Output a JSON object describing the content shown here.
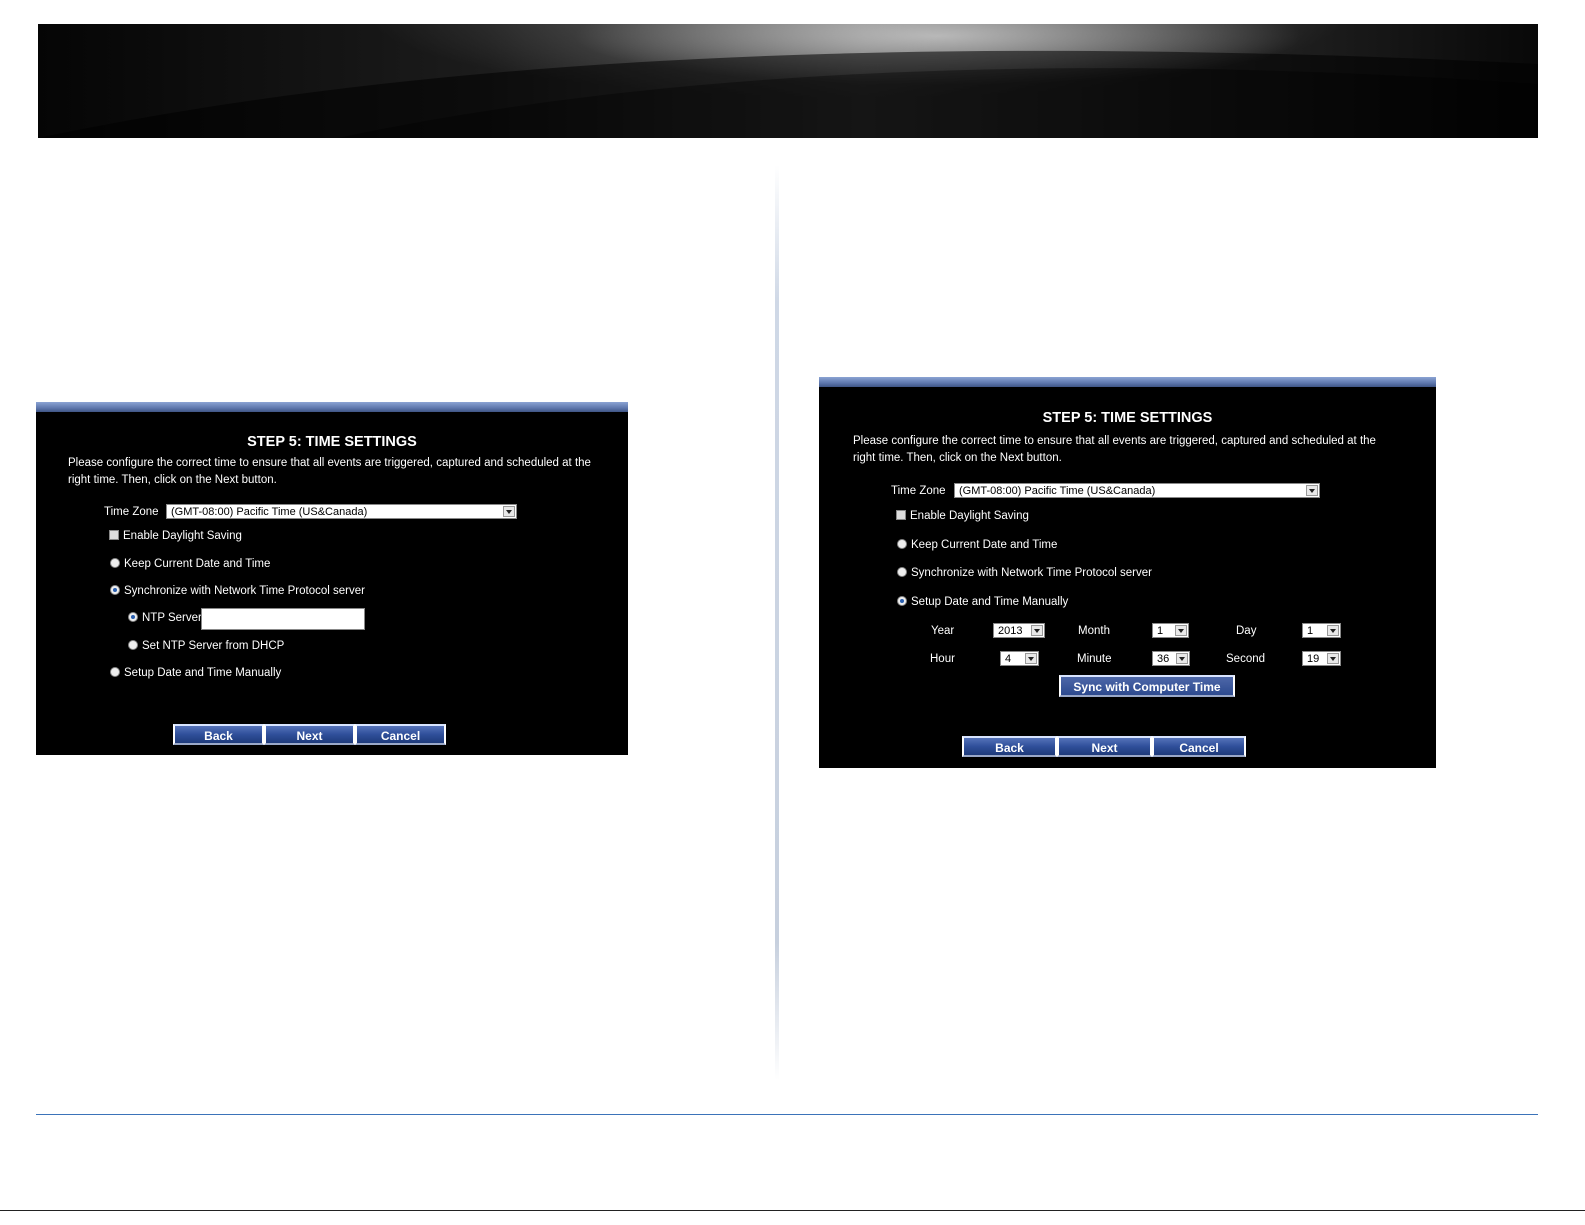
{
  "left_panel": {
    "title": "STEP 5: TIME SETTINGS",
    "description_line1": "Please configure the correct time to ensure that all events are triggered, captured and scheduled at the",
    "description_line2": "right time. Then, click on the Next button.",
    "time_zone_label": "Time Zone",
    "time_zone_value": "(GMT-08:00) Pacific Time (US&Canada)",
    "daylight_label": "Enable Daylight Saving",
    "daylight_checked": false,
    "option_keep": "Keep Current Date and Time",
    "option_sync": "Synchronize with Network Time Protocol server",
    "ntp_server_label": "NTP Server",
    "ntp_server_value": "",
    "ntp_dhcp_label": "Set NTP Server from DHCP",
    "option_manual": "Setup Date and Time Manually",
    "selected_option": "Synchronize with Network Time Protocol server",
    "buttons": {
      "back": "Back",
      "next": "Next",
      "cancel": "Cancel"
    }
  },
  "right_panel": {
    "title": "STEP 5: TIME SETTINGS",
    "description_line1": "Please configure the correct time to ensure that all events are triggered, captured and scheduled at the",
    "description_line2": "right time. Then, click on the Next button.",
    "time_zone_label": "Time Zone",
    "time_zone_value": "(GMT-08:00) Pacific Time (US&Canada)",
    "daylight_label": "Enable Daylight Saving",
    "daylight_checked": false,
    "option_keep": "Keep Current Date and Time",
    "option_sync": "Synchronize with Network Time Protocol server",
    "option_manual": "Setup Date and Time Manually",
    "selected_option": "Setup Date and Time Manually",
    "fields": {
      "year_label": "Year",
      "year_value": "2013",
      "month_label": "Month",
      "month_value": "1",
      "day_label": "Day",
      "day_value": "1",
      "hour_label": "Hour",
      "hour_value": "4",
      "minute_label": "Minute",
      "minute_value": "36",
      "second_label": "Second",
      "second_value": "19"
    },
    "sync_button": "Sync with Computer Time",
    "buttons": {
      "back": "Back",
      "next": "Next",
      "cancel": "Cancel"
    }
  },
  "colors": {
    "panel_bg": "#000000",
    "title_bar": "#5e77ad",
    "rule": "#3b73b9"
  }
}
